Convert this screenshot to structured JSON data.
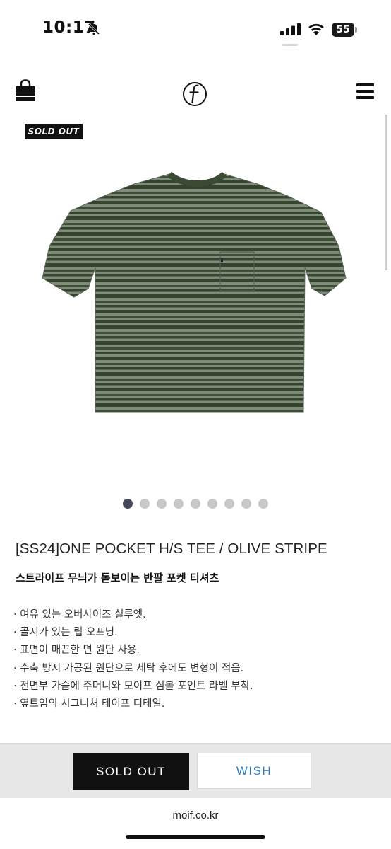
{
  "status_bar": {
    "time": "10:17",
    "battery": "55",
    "icons": [
      "bell-slash-icon",
      "signal-icon",
      "wifi-icon",
      "battery-icon"
    ]
  },
  "header": {
    "icons": [
      "shopping-bag-icon",
      "brand-logo",
      "menu-icon"
    ],
    "logo_text": "f"
  },
  "product": {
    "badge": "SOLD OUT",
    "title": "[SS24]ONE POCKET H/S TEE / OLIVE STRIPE",
    "subtitle": "스트라이프 무늬가 돋보이는 반팔 포켓 티셔츠",
    "features": [
      "· 여유 있는 오버사이즈 실루엣.",
      "· 골지가 있는 립 오프닝.",
      "· 표면이 매끈한 면 원단 사용.",
      "· 수축 방지 가공된 원단으로 세탁 후에도 변형이 적음.",
      "· 전면부 가슴에 주머니와 모이프 심볼 포인트 라벨 부착.",
      "· 옆트임의 시그니처 테이프 디테일."
    ],
    "image_count": 9,
    "active_image": 1,
    "colors": {
      "shirt_base": "#7d8a79",
      "stripe": "#3a4a30"
    }
  },
  "actions": {
    "sold_out_label": "SOLD OUT",
    "wish_label": "WISH",
    "wish_color": "#2b7bb9"
  },
  "browser": {
    "url": "moif.co.kr"
  }
}
